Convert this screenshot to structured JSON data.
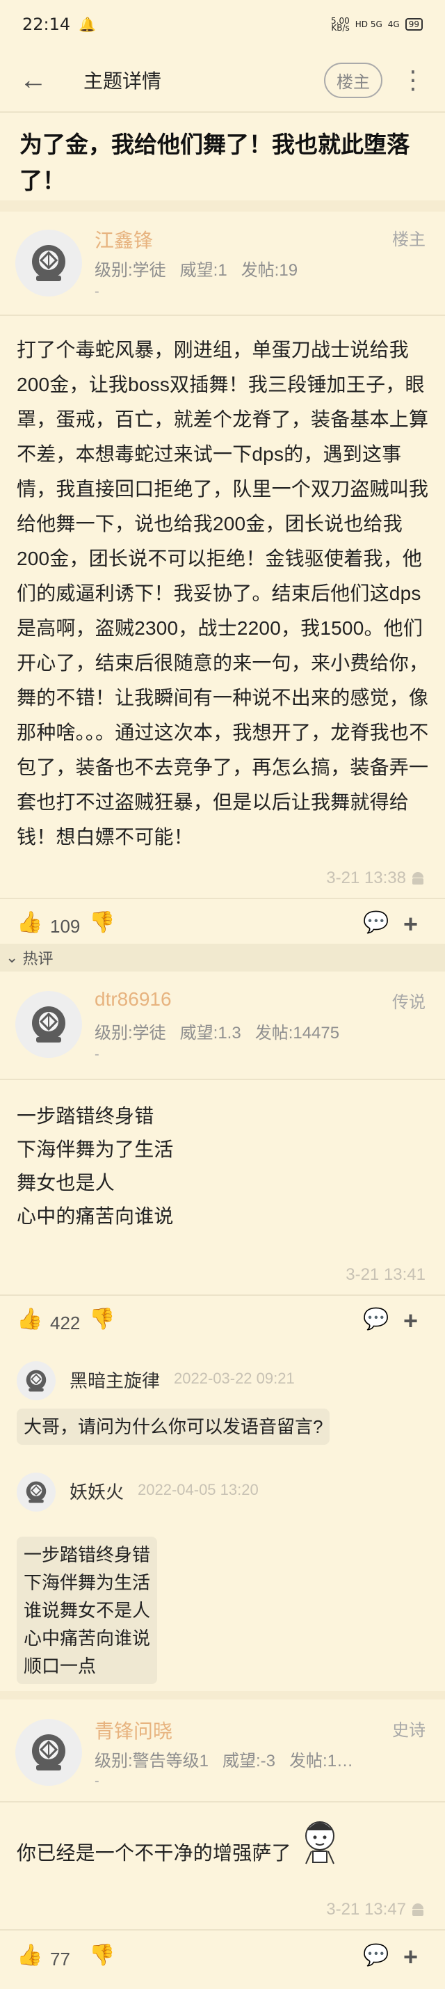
{
  "status_bar": {
    "time": "22:14",
    "speed_top": "5.00",
    "speed_bottom": "KB/s",
    "network_1": "HD 5G",
    "network_2": "4G",
    "battery": "99"
  },
  "nav": {
    "back_icon": "arrow-left-icon",
    "title": "主题详情",
    "owner_toggle": "楼主",
    "more_icon": "more-vertical-icon"
  },
  "post": {
    "title": "为了金，我给他们舞了！我也就此堕落了！"
  },
  "floors": [
    {
      "username": "江鑫锋",
      "level": "级别:学徒",
      "prestige": "威望:1",
      "posts": "发帖:19",
      "dash": "-",
      "badge": "楼主",
      "content": "打了个毒蛇风暴，刚进组，单蛋刀战士说给我200金，让我boss双插舞！我三段锤加王子，眼罩，蛋戒，百亡，就差个龙脊了，装备基本上算不差，本想毒蛇过来试一下dps的，遇到这事情，我直接回口拒绝了，队里一个双刀盗贼叫我给他舞一下，说也给我200金，团长说也给我200金，团长说不可以拒绝！金钱驱使着我，他们的威逼利诱下！我妥协了。结束后他们这dps是高啊，盗贼2300，战士2200，我1500。他们开心了，结束后很随意的来一句，来小费给你，舞的不错！让我瞬间有一种说不出来的感觉，像那种啥。。。通过这次本，我想开了，龙脊我也不包了，装备也不去竞争了，再怎么搞，装备弄一套也打不过盗贼狂暴，但是以后让我舞就得给钱！想白嫖不可能！",
      "timestamp": "3-21 13:38",
      "likes": "109"
    },
    {
      "username": "dtr86916",
      "level": "级别:学徒",
      "prestige": "威望:1.3",
      "posts": "发帖:14475",
      "dash": "-",
      "badge": "传说",
      "content_lines": [
        "一步踏错终身错",
        "下海伴舞为了生活",
        "舞女也是人",
        "心中的痛苦向谁说"
      ],
      "timestamp": "3-21 13:41",
      "likes": "422"
    },
    {
      "username": "青锋问晓",
      "level": "级别:警告等级1",
      "prestige": "威望:-3",
      "posts": "发帖:1…",
      "dash": "-",
      "badge": "史诗",
      "content": "你已经是一个不干净的增强萨了",
      "timestamp": "3-21 13:47",
      "likes": "77"
    }
  ],
  "hot_section": {
    "label": "热评"
  },
  "replies": [
    {
      "name": "黑暗主旋律",
      "date": "2022-03-22 09:21",
      "text": "大哥，请问为什么你可以发语音留言?"
    },
    {
      "name": "妖妖火",
      "date": "2022-04-05 13:20",
      "lines": [
        "一步踏错终身错",
        "下海伴舞为生活",
        "谁说舞女不是人",
        "心中痛苦向谁说",
        "顺口一点"
      ]
    }
  ],
  "icons": {
    "like": "thumb-up-icon",
    "dislike": "thumb-down-icon",
    "comment": "comment-icon",
    "add": "plus-icon",
    "device": "android-icon",
    "avatar": "diving-helmet-icon"
  }
}
